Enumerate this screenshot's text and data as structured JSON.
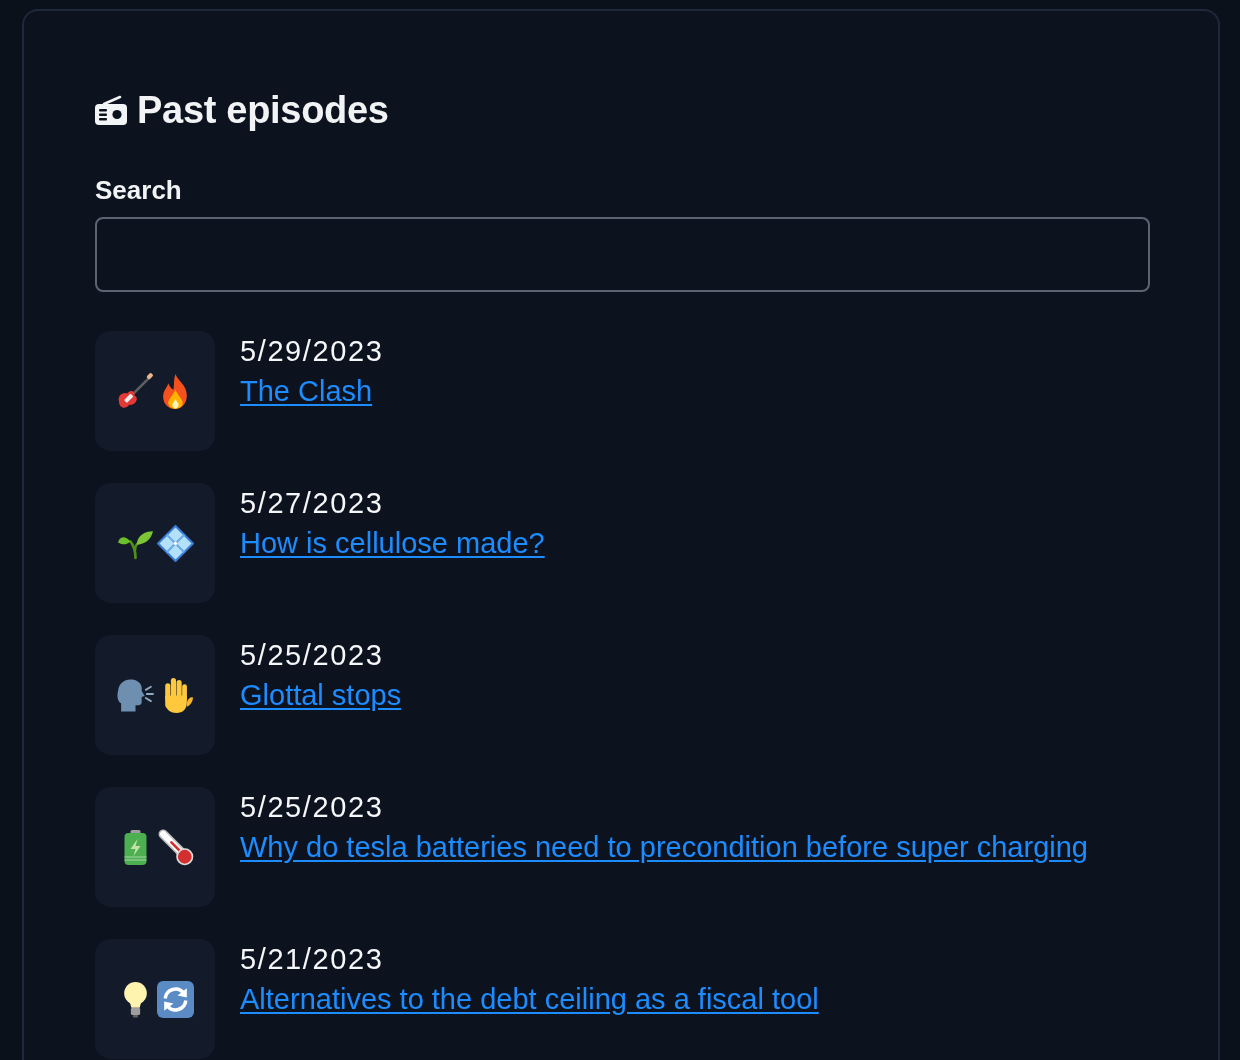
{
  "header": {
    "title": "Past episodes"
  },
  "search": {
    "label": "Search"
  },
  "episodes": [
    {
      "date": "5/29/2023",
      "title": "The Clash"
    },
    {
      "date": "5/27/2023",
      "title": "How is cellulose made?"
    },
    {
      "date": "5/25/2023",
      "title": "Glottal stops"
    },
    {
      "date": "5/25/2023",
      "title": "Why do tesla batteries need to precondition before super charging"
    },
    {
      "date": "5/21/2023",
      "title": "Alternatives to the debt ceiling as a fiscal tool"
    }
  ]
}
